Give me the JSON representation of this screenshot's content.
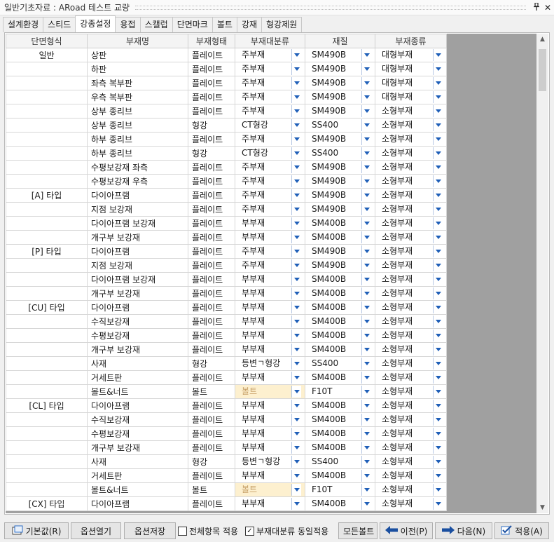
{
  "window": {
    "title": "일반기초자료 : ARoad 테스트 교량",
    "pin_label": "ᵖ",
    "close_label": "✕"
  },
  "tabs": [
    "설계환경",
    "스티드",
    "강종설정",
    "용접",
    "스캘럽",
    "단면마크",
    "볼트",
    "강재",
    "형강제원"
  ],
  "active_tab": 2,
  "columns": [
    "단면형식",
    "부재명",
    "부재형태",
    "부재대분류",
    "재질",
    "부재종류"
  ],
  "rows": [
    {
      "type": "일반",
      "name": "상판",
      "form": "플레이트",
      "major": "주부재",
      "mat": "SM490B",
      "kind": "대형부재"
    },
    {
      "type": "",
      "name": "하판",
      "form": "플레이트",
      "major": "주부재",
      "mat": "SM490B",
      "kind": "대형부재"
    },
    {
      "type": "",
      "name": "좌측 복부판",
      "form": "플레이트",
      "major": "주부재",
      "mat": "SM490B",
      "kind": "대형부재"
    },
    {
      "type": "",
      "name": "우측 복부판",
      "form": "플레이트",
      "major": "주부재",
      "mat": "SM490B",
      "kind": "대형부재"
    },
    {
      "type": "",
      "name": "상부 종리브",
      "form": "플레이트",
      "major": "주부재",
      "mat": "SM490B",
      "kind": "소형부재"
    },
    {
      "type": "",
      "name": "상부 종리브",
      "form": "형강",
      "major": "CT형강",
      "mat": "SS400",
      "kind": "소형부재"
    },
    {
      "type": "",
      "name": "하부 종리브",
      "form": "플레이트",
      "major": "주부재",
      "mat": "SM490B",
      "kind": "소형부재"
    },
    {
      "type": "",
      "name": "하부 종리브",
      "form": "형강",
      "major": "CT형강",
      "mat": "SS400",
      "kind": "소형부재"
    },
    {
      "type": "",
      "name": "수평보강재 좌측",
      "form": "플레이트",
      "major": "주부재",
      "mat": "SM490B",
      "kind": "소형부재"
    },
    {
      "type": "",
      "name": "수평보강재 우측",
      "form": "플레이트",
      "major": "주부재",
      "mat": "SM490B",
      "kind": "소형부재"
    },
    {
      "type": "[A] 타입",
      "name": "다이아프램",
      "form": "플레이트",
      "major": "주부재",
      "mat": "SM490B",
      "kind": "소형부재"
    },
    {
      "type": "",
      "name": "지점 보강재",
      "form": "플레이트",
      "major": "주부재",
      "mat": "SM490B",
      "kind": "소형부재"
    },
    {
      "type": "",
      "name": "다이아프램 보강재",
      "form": "플레이트",
      "major": "부부재",
      "mat": "SM400B",
      "kind": "소형부재"
    },
    {
      "type": "",
      "name": "개구부 보강재",
      "form": "플레이트",
      "major": "부부재",
      "mat": "SM400B",
      "kind": "소형부재"
    },
    {
      "type": "[P] 타입",
      "name": "다이아프램",
      "form": "플레이트",
      "major": "주부재",
      "mat": "SM490B",
      "kind": "소형부재"
    },
    {
      "type": "",
      "name": "지점 보강재",
      "form": "플레이트",
      "major": "주부재",
      "mat": "SM490B",
      "kind": "소형부재"
    },
    {
      "type": "",
      "name": "다이아프램 보강재",
      "form": "플레이트",
      "major": "부부재",
      "mat": "SM400B",
      "kind": "소형부재"
    },
    {
      "type": "",
      "name": "개구부 보강재",
      "form": "플레이트",
      "major": "부부재",
      "mat": "SM400B",
      "kind": "소형부재"
    },
    {
      "type": "[CU] 타입",
      "name": "다이아프램",
      "form": "플레이트",
      "major": "부부재",
      "mat": "SM400B",
      "kind": "소형부재"
    },
    {
      "type": "",
      "name": "수직보강재",
      "form": "플레이트",
      "major": "부부재",
      "mat": "SM400B",
      "kind": "소형부재"
    },
    {
      "type": "",
      "name": "수평보강재",
      "form": "플레이트",
      "major": "부부재",
      "mat": "SM400B",
      "kind": "소형부재"
    },
    {
      "type": "",
      "name": "개구부 보강재",
      "form": "플레이트",
      "major": "부부재",
      "mat": "SM400B",
      "kind": "소형부재"
    },
    {
      "type": "",
      "name": "사재",
      "form": "형강",
      "major": "등변ㄱ형강",
      "mat": "SS400",
      "kind": "소형부재"
    },
    {
      "type": "",
      "name": "거세트판",
      "form": "플레이트",
      "major": "부부재",
      "mat": "SM400B",
      "kind": "소형부재"
    },
    {
      "type": "",
      "name": "볼트&너트",
      "form": "볼트",
      "major": "볼트",
      "mat": "F10T",
      "kind": "소형부재",
      "disabled": true
    },
    {
      "type": "[CL] 타입",
      "name": "다이아프램",
      "form": "플레이트",
      "major": "부부재",
      "mat": "SM400B",
      "kind": "소형부재"
    },
    {
      "type": "",
      "name": "수직보강재",
      "form": "플레이트",
      "major": "부부재",
      "mat": "SM400B",
      "kind": "소형부재"
    },
    {
      "type": "",
      "name": "수평보강재",
      "form": "플레이트",
      "major": "부부재",
      "mat": "SM400B",
      "kind": "소형부재"
    },
    {
      "type": "",
      "name": "개구부 보강재",
      "form": "플레이트",
      "major": "부부재",
      "mat": "SM400B",
      "kind": "소형부재"
    },
    {
      "type": "",
      "name": "사재",
      "form": "형강",
      "major": "등변ㄱ형강",
      "mat": "SS400",
      "kind": "소형부재"
    },
    {
      "type": "",
      "name": "거세트판",
      "form": "플레이트",
      "major": "부부재",
      "mat": "SM400B",
      "kind": "소형부재"
    },
    {
      "type": "",
      "name": "볼트&너트",
      "form": "볼트",
      "major": "볼트",
      "mat": "F10T",
      "kind": "소형부재",
      "disabled": true
    },
    {
      "type": "[CX] 타입",
      "name": "다이아프램",
      "form": "플레이트",
      "major": "부부재",
      "mat": "SM400B",
      "kind": "소형부재"
    }
  ],
  "bottom": {
    "default_btn": "기본값(R)",
    "open_opt": "옵션열기",
    "save_opt": "옵션저장",
    "apply_all": "전체항목 적용",
    "same_apply": "부재대분류 동일적용",
    "all_bolt": "모든볼트",
    "prev": "이전(P)",
    "next": "다음(N)",
    "apply": "적용(A)"
  },
  "colors": {
    "dropdown_arrow": "#1f5fb8",
    "disabled_text": "#c8a26a",
    "disabled_bg": "#fdf0cf",
    "nav_arrow": "#1a4fa0"
  }
}
